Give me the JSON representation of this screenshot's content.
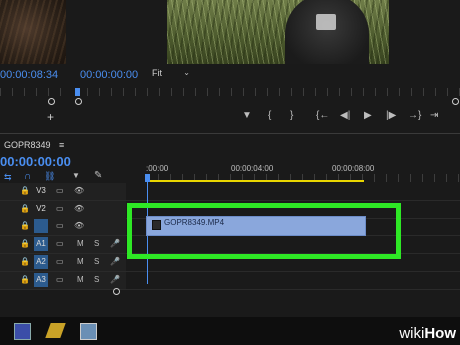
{
  "source_monitor": {
    "timecode": "00:00:08:34"
  },
  "program_monitor": {
    "timecode": "00:00:00:00",
    "fit_label": "Fit",
    "transport": [
      "▼",
      "{",
      "}",
      "{←",
      "◀|",
      "▶",
      "|▶",
      "→}",
      "⇥",
      "⊕"
    ]
  },
  "timeline": {
    "sequence_name": "GOPR8349",
    "menu_glyph": "≡",
    "timecode": "00:00:00:00",
    "ruler_labels": [
      ":00:00",
      "00:00:04:00",
      "00:00:08:00"
    ],
    "video_tracks": [
      "V3",
      "V2",
      "V1"
    ],
    "audio_tracks": [
      "A1",
      "A2",
      "A3"
    ],
    "source_patch_v": "V1",
    "clip": {
      "name": "GOPR8349.MP4"
    },
    "track_toggles": {
      "mute": "M",
      "solo": "S"
    }
  },
  "watermark": {
    "brand_1": "wiki",
    "brand_2": "How"
  },
  "colors": {
    "accent_blue": "#4a8ef0",
    "highlight_green": "#2ee825",
    "clip_blue": "#8aa7dc"
  }
}
